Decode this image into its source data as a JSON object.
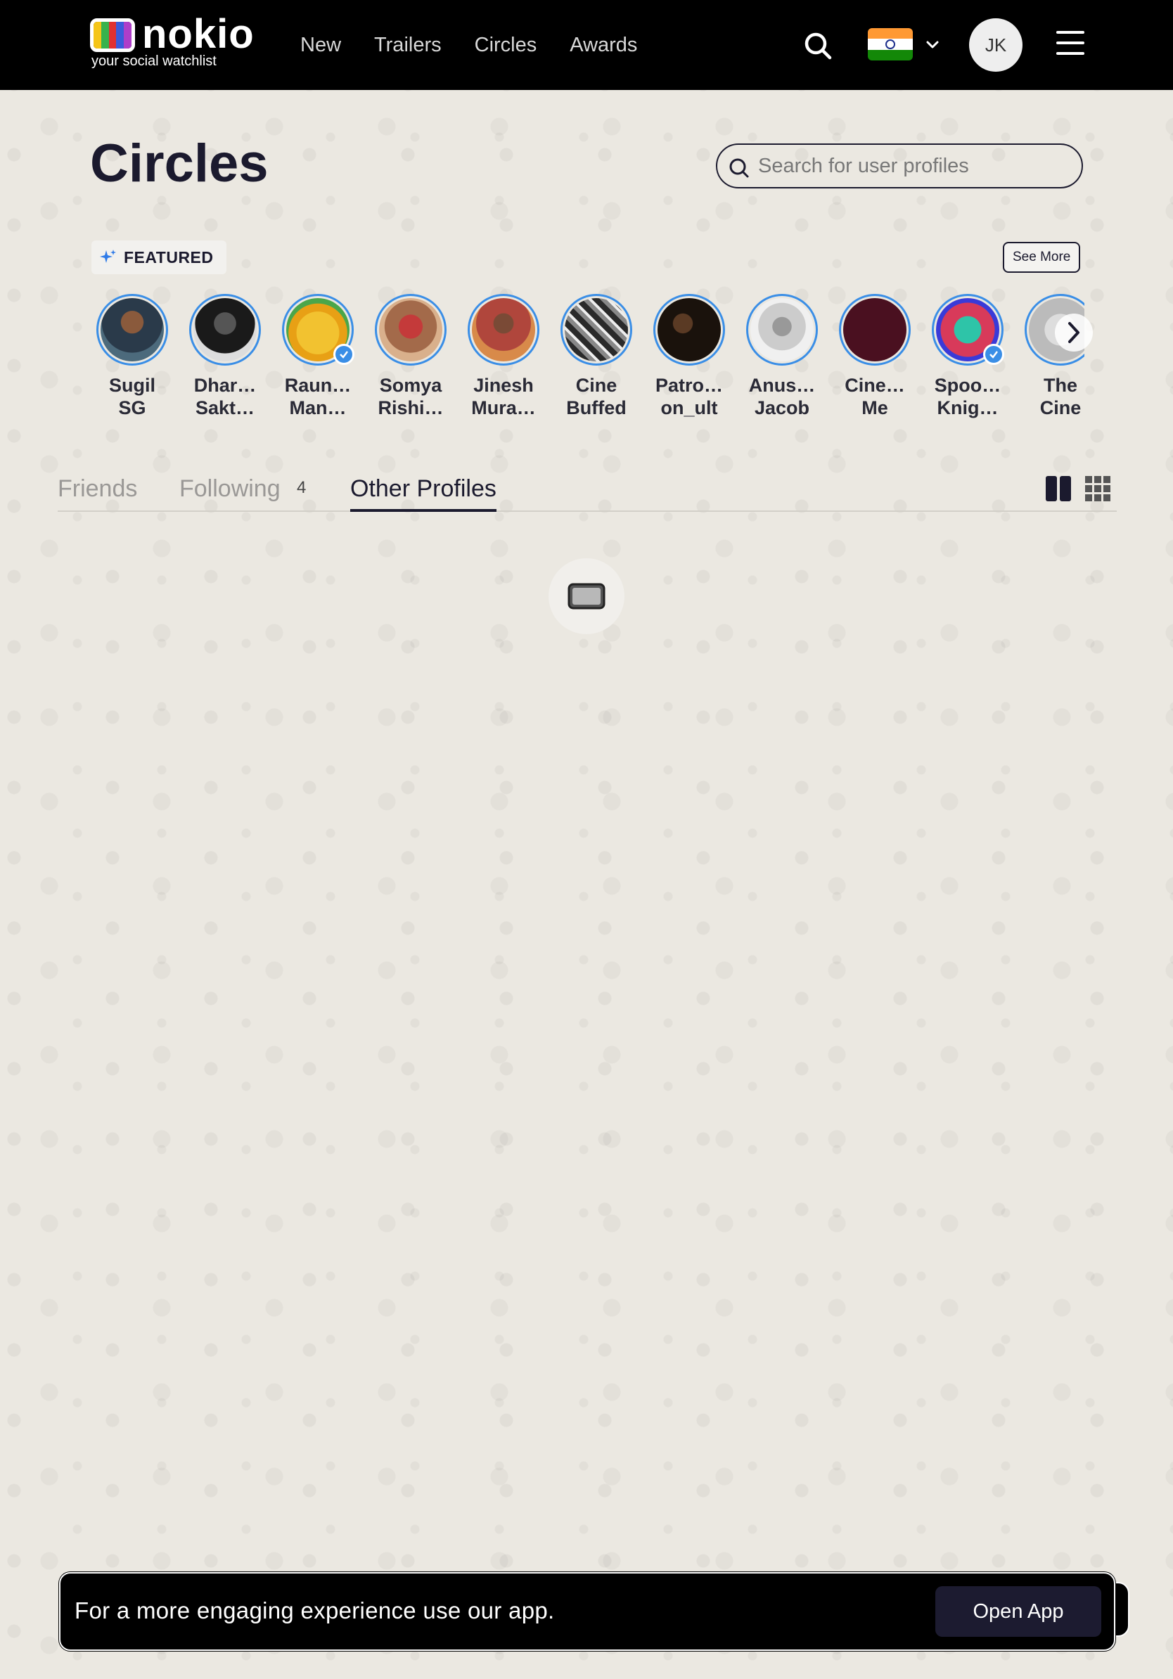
{
  "header": {
    "logo_word": "nokio",
    "logo_tagline": "your social watchlist",
    "nav": [
      "New",
      "Trailers",
      "Circles",
      "Awards"
    ],
    "user_initials": "JK",
    "country": "India"
  },
  "page": {
    "title": "Circles",
    "search_placeholder": "Search for user profiles"
  },
  "featured": {
    "label": "FEATURED",
    "see_more": "See More",
    "profiles": [
      {
        "name": "Sugil\nSG",
        "verified": false
      },
      {
        "name": "Dhar…\nSakt…",
        "verified": false
      },
      {
        "name": "Raun…\nMan…",
        "verified": true
      },
      {
        "name": "Somya\nRishi…",
        "verified": false
      },
      {
        "name": "Jinesh\nMura…",
        "verified": false
      },
      {
        "name": "Cine\nBuffed",
        "verified": false
      },
      {
        "name": "Patro…\non_ult",
        "verified": false
      },
      {
        "name": "Anus…\nJacob",
        "verified": false
      },
      {
        "name": "Cine…\nMe",
        "verified": false
      },
      {
        "name": "Spoo…\nKnig…",
        "verified": true
      },
      {
        "name": "The\nCine",
        "verified": false
      }
    ]
  },
  "tabs": {
    "friends": "Friends",
    "following": "Following",
    "following_count": "4",
    "other": "Other Profiles",
    "active": "other"
  },
  "banner": {
    "text": "For a more engaging experience use our app.",
    "button": "Open App"
  },
  "colors": {
    "accent_ring": "#3a8ee6",
    "header_bg": "#000000",
    "page_bg": "#ebe8e1",
    "primary_dark": "#1b1a2e"
  }
}
